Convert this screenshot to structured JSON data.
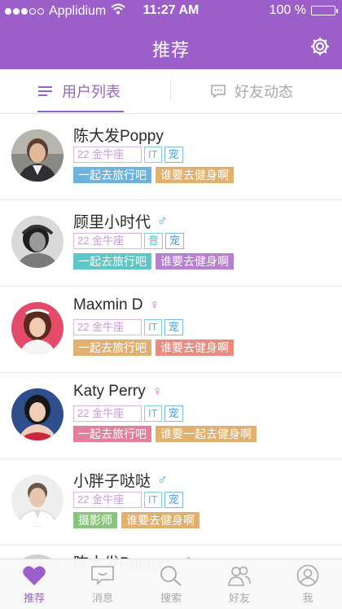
{
  "status_bar": {
    "carrier": "Applidium",
    "time": "11:27 AM",
    "battery": "100 %"
  },
  "nav": {
    "title": "推荐",
    "settings_icon": "gear-icon"
  },
  "tabs": [
    {
      "label": "用户列表",
      "icon": "list-icon",
      "active": true
    },
    {
      "label": "好友动态",
      "icon": "chat-bubble-icon",
      "active": false
    }
  ],
  "users": [
    {
      "name": "陈大发Poppy",
      "gender": "",
      "age_sign": "22 金牛座",
      "job": "IT",
      "pet": "宠",
      "hobbies": [
        {
          "text": "一起去旅行吧",
          "color": "#6cb2e0"
        },
        {
          "text": "谁要去健身啊",
          "color": "#e1b06f"
        }
      ]
    },
    {
      "name": "顾里小时代",
      "gender": "male",
      "age_sign": "22 金牛座",
      "job": "音",
      "pet": "宠",
      "hobbies": [
        {
          "text": "一起去旅行吧",
          "color": "#5dc6c6"
        },
        {
          "text": "谁要去健身啊",
          "color": "#b77fd0"
        }
      ]
    },
    {
      "name": "Maxmin D",
      "gender": "female",
      "age_sign": "22 金牛座",
      "job": "IT",
      "pet": "宠",
      "hobbies": [
        {
          "text": "一起去旅行吧",
          "color": "#e1b06f"
        },
        {
          "text": "谁要去健身啊",
          "color": "#e98b7e"
        }
      ]
    },
    {
      "name": "Katy Perry",
      "gender": "female",
      "age_sign": "22 金牛座",
      "job": "IT",
      "pet": "宠",
      "hobbies": [
        {
          "text": "一起去旅行吧",
          "color": "#e37f9a"
        },
        {
          "text": "谁要一起去健身啊",
          "color": "#e1b06f"
        }
      ]
    },
    {
      "name": "小胖子哒哒",
      "gender": "male",
      "age_sign": "22 金牛座",
      "job": "IT",
      "pet": "宠",
      "hobbies": [
        {
          "text": "摄影师",
          "color": "#88c57a"
        },
        {
          "text": "谁要去健身啊",
          "color": "#e1b06f"
        }
      ]
    }
  ],
  "partial_user": {
    "name": "陈大发Poppy"
  },
  "tabbar": [
    {
      "label": "推荐",
      "icon": "heart-icon",
      "active": true
    },
    {
      "label": "消息",
      "icon": "message-icon",
      "active": false
    },
    {
      "label": "搜索",
      "icon": "search-icon",
      "active": false
    },
    {
      "label": "好友",
      "icon": "friends-icon",
      "active": false
    },
    {
      "label": "我",
      "icon": "profile-icon",
      "active": false
    }
  ],
  "colors": {
    "accent": "#9c5fc9",
    "male": "#4a9bd6",
    "female": "#c86ec6"
  }
}
